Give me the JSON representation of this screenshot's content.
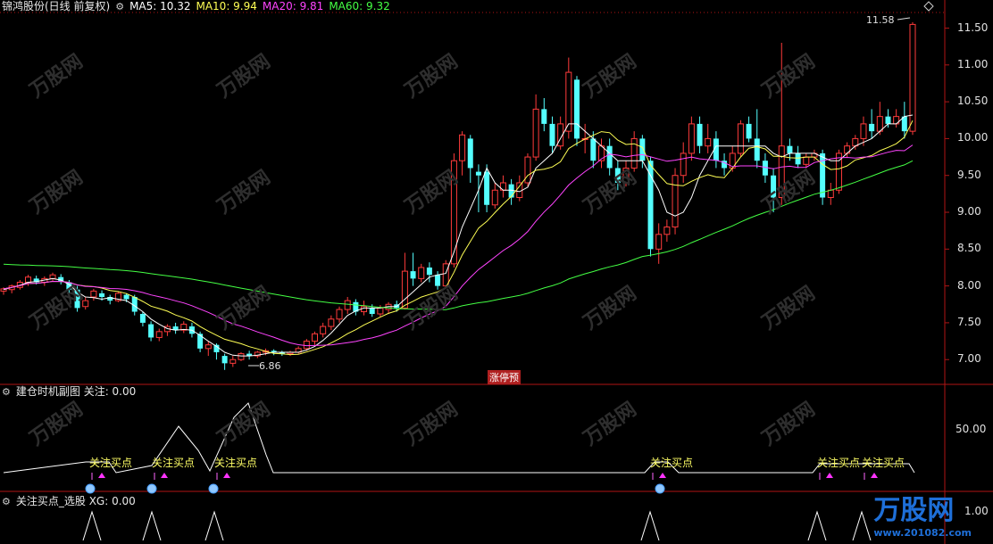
{
  "main": {
    "title": "锦鸿股份(日线 前复权)",
    "ma": [
      {
        "label": "MA5: 10.32",
        "color": "#ffffff"
      },
      {
        "label": "MA10: 9.94",
        "color": "#ffff55"
      },
      {
        "label": "MA20: 9.81",
        "color": "#ff44ff"
      },
      {
        "label": "MA60: 9.32",
        "color": "#44ff44"
      }
    ],
    "y_ticks": [
      "11.50",
      "11.00",
      "10.50",
      "10.00",
      "9.50",
      "9.00",
      "8.50",
      "8.00",
      "7.50",
      "7.00"
    ],
    "high_label": "11.58",
    "low_label": "6.86",
    "limit_tag": "涨停预"
  },
  "sub1": {
    "title": "建仓时机副图 关注: 0.00",
    "y_tick": "50.00",
    "signals": [
      "关注买点",
      "关注买点",
      "关注买点",
      "关注买点",
      "关注买点",
      "关注买点"
    ]
  },
  "sub2": {
    "title": "关注买点_选股 XG: 0.00",
    "y_tick": "1.00"
  },
  "watermark": "万股网",
  "logo": {
    "text": "万股网",
    "url": "www.201082.com"
  },
  "colors": {
    "up": "#ff3b3b",
    "down": "#54ffff",
    "grid": "#b01515"
  },
  "chart_data": {
    "type": "candlestick",
    "ylim": [
      6.7,
      11.7
    ],
    "candles": [
      [
        7.93,
        7.96,
        7.88,
        7.98
      ],
      [
        7.95,
        8.0,
        7.9,
        8.02
      ],
      [
        7.98,
        8.05,
        7.95,
        8.08
      ],
      [
        8.05,
        8.12,
        8.0,
        8.15
      ],
      [
        8.1,
        8.05,
        8.02,
        8.14
      ],
      [
        8.05,
        8.1,
        8.0,
        8.13
      ],
      [
        8.1,
        8.15,
        8.06,
        8.18
      ],
      [
        8.12,
        8.06,
        8.02,
        8.16
      ],
      [
        8.05,
        7.95,
        7.9,
        8.08
      ],
      [
        7.95,
        7.7,
        7.65,
        8.0
      ],
      [
        7.72,
        7.8,
        7.68,
        7.85
      ],
      [
        7.85,
        7.93,
        7.8,
        7.96
      ],
      [
        7.9,
        7.85,
        7.8,
        7.94
      ],
      [
        7.85,
        7.8,
        7.75,
        7.88
      ],
      [
        7.8,
        7.9,
        7.78,
        7.92
      ],
      [
        7.88,
        7.82,
        7.78,
        7.9
      ],
      [
        7.85,
        7.65,
        7.6,
        7.88
      ],
      [
        7.62,
        7.5,
        7.45,
        7.65
      ],
      [
        7.48,
        7.3,
        7.25,
        7.52
      ],
      [
        7.3,
        7.38,
        7.25,
        7.42
      ],
      [
        7.38,
        7.45,
        7.32,
        7.48
      ],
      [
        7.45,
        7.4,
        7.35,
        7.5
      ],
      [
        7.4,
        7.48,
        7.36,
        7.52
      ],
      [
        7.45,
        7.35,
        7.3,
        7.5
      ],
      [
        7.35,
        7.15,
        7.1,
        7.38
      ],
      [
        7.15,
        7.2,
        7.05,
        7.25
      ],
      [
        7.2,
        7.1,
        7.0,
        7.22
      ],
      [
        7.05,
        6.95,
        6.86,
        7.08
      ],
      [
        6.95,
        7.0,
        6.9,
        7.05
      ],
      [
        7.0,
        7.08,
        6.98,
        7.1
      ],
      [
        7.08,
        7.05,
        7.0,
        7.12
      ],
      [
        7.05,
        7.1,
        7.02,
        7.12
      ],
      [
        7.1,
        7.12,
        7.06,
        7.15
      ],
      [
        7.12,
        7.1,
        7.06,
        7.14
      ],
      [
        7.1,
        7.08,
        7.05,
        7.12
      ],
      [
        7.08,
        7.1,
        7.05,
        7.12
      ],
      [
        7.1,
        7.15,
        7.08,
        7.18
      ],
      [
        7.15,
        7.25,
        7.12,
        7.28
      ],
      [
        7.25,
        7.35,
        7.2,
        7.38
      ],
      [
        7.35,
        7.45,
        7.3,
        7.5
      ],
      [
        7.45,
        7.55,
        7.4,
        7.6
      ],
      [
        7.55,
        7.68,
        7.5,
        7.72
      ],
      [
        7.68,
        7.8,
        7.62,
        7.85
      ],
      [
        7.78,
        7.65,
        7.6,
        7.82
      ],
      [
        7.65,
        7.72,
        7.6,
        7.8
      ],
      [
        7.7,
        7.62,
        7.58,
        7.75
      ],
      [
        7.62,
        7.7,
        7.58,
        7.74
      ],
      [
        7.68,
        7.75,
        7.62,
        7.78
      ],
      [
        7.75,
        7.7,
        7.65,
        7.8
      ],
      [
        7.7,
        8.2,
        7.68,
        8.45
      ],
      [
        8.2,
        8.1,
        8.0,
        8.45
      ],
      [
        8.1,
        8.25,
        8.05,
        8.3
      ],
      [
        8.25,
        8.15,
        8.05,
        8.32
      ],
      [
        8.15,
        8.0,
        7.95,
        8.2
      ],
      [
        8.0,
        8.3,
        7.98,
        8.35
      ],
      [
        8.3,
        9.7,
        8.25,
        9.8
      ],
      [
        9.7,
        10.05,
        9.5,
        10.1
      ],
      [
        10.0,
        9.6,
        9.4,
        10.05
      ],
      [
        9.55,
        9.5,
        9.0,
        9.65
      ],
      [
        9.55,
        9.1,
        9.0,
        9.65
      ],
      [
        9.1,
        9.3,
        9.05,
        9.4
      ],
      [
        9.3,
        9.4,
        9.2,
        9.5
      ],
      [
        9.38,
        9.2,
        9.1,
        9.45
      ],
      [
        9.2,
        9.4,
        9.15,
        9.5
      ],
      [
        9.4,
        9.75,
        9.35,
        9.8
      ],
      [
        9.75,
        10.4,
        9.7,
        10.6
      ],
      [
        10.4,
        10.2,
        10.1,
        10.55
      ],
      [
        10.2,
        9.9,
        9.8,
        10.3
      ],
      [
        9.9,
        10.2,
        9.85,
        10.3
      ],
      [
        10.1,
        10.9,
        10.0,
        11.1
      ],
      [
        10.8,
        10.0,
        9.9,
        10.85
      ],
      [
        10.0,
        10.0,
        9.8,
        10.2
      ],
      [
        10.0,
        9.7,
        9.6,
        10.1
      ],
      [
        9.7,
        9.9,
        9.6,
        10.0
      ],
      [
        9.9,
        9.6,
        9.5,
        10.0
      ],
      [
        9.6,
        9.4,
        9.3,
        9.7
      ],
      [
        9.4,
        9.6,
        9.35,
        9.7
      ],
      [
        9.6,
        10.0,
        9.55,
        10.1
      ],
      [
        10.0,
        9.7,
        9.6,
        10.05
      ],
      [
        9.7,
        8.5,
        8.4,
        9.75
      ],
      [
        8.5,
        8.7,
        8.3,
        8.85
      ],
      [
        8.7,
        8.8,
        8.6,
        8.9
      ],
      [
        8.8,
        9.5,
        8.7,
        9.6
      ],
      [
        9.5,
        9.8,
        9.4,
        9.95
      ],
      [
        9.8,
        10.2,
        9.7,
        10.3
      ],
      [
        10.2,
        9.9,
        9.8,
        10.3
      ],
      [
        9.9,
        10.0,
        9.8,
        10.2
      ],
      [
        10.0,
        9.7,
        9.6,
        10.1
      ],
      [
        9.7,
        9.6,
        9.5,
        9.8
      ],
      [
        9.6,
        9.8,
        9.55,
        9.9
      ],
      [
        9.8,
        10.2,
        9.75,
        10.25
      ],
      [
        10.2,
        10.0,
        9.95,
        10.3
      ],
      [
        10.0,
        9.7,
        9.6,
        10.4
      ],
      [
        9.7,
        9.5,
        9.4,
        9.8
      ],
      [
        9.5,
        9.2,
        9.0,
        9.6
      ],
      [
        9.2,
        9.9,
        9.1,
        11.3
      ],
      [
        9.9,
        9.8,
        9.7,
        10.0
      ],
      [
        9.8,
        9.65,
        9.6,
        9.9
      ],
      [
        9.65,
        9.75,
        9.6,
        9.8
      ],
      [
        9.75,
        9.8,
        9.7,
        9.85
      ],
      [
        9.8,
        9.2,
        9.1,
        9.85
      ],
      [
        9.2,
        9.3,
        9.1,
        9.4
      ],
      [
        9.3,
        9.8,
        9.25,
        9.85
      ],
      [
        9.8,
        9.9,
        9.75,
        9.95
      ],
      [
        9.9,
        10.0,
        9.85,
        10.05
      ],
      [
        10.0,
        10.2,
        9.9,
        10.3
      ],
      [
        10.2,
        10.1,
        10.0,
        10.4
      ],
      [
        10.1,
        10.3,
        10.05,
        10.5
      ],
      [
        10.3,
        10.2,
        10.15,
        10.4
      ],
      [
        10.2,
        10.3,
        10.15,
        10.4
      ],
      [
        10.3,
        10.1,
        10.0,
        10.5
      ],
      [
        10.1,
        11.55,
        10.05,
        11.58
      ]
    ],
    "ma5": [
      7.95,
      7.98,
      8.01,
      8.05,
      8.06,
      8.08,
      8.1,
      8.08,
      8.02,
      7.92,
      7.85,
      7.84,
      7.82,
      7.84,
      7.82,
      7.8,
      7.73,
      7.65,
      7.55,
      7.48,
      7.42,
      7.4,
      7.41,
      7.4,
      7.33,
      7.25,
      7.18,
      7.1,
      7.06,
      7.05,
      7.05,
      7.06,
      7.08,
      7.1,
      7.1,
      7.1,
      7.1,
      7.13,
      7.18,
      7.26,
      7.36,
      7.48,
      7.6,
      7.66,
      7.7,
      7.7,
      7.7,
      7.72,
      7.72,
      7.82,
      7.92,
      8.02,
      8.12,
      8.15,
      8.17,
      8.46,
      8.8,
      9.05,
      9.3,
      9.6,
      9.4,
      9.3,
      9.3,
      9.28,
      9.34,
      9.6,
      9.7,
      9.8,
      10.0,
      10.2,
      10.2,
      10.1,
      10.0,
      9.9,
      9.8,
      9.7,
      9.7,
      9.7,
      9.7,
      9.5,
      9.3,
      9.0,
      8.95,
      9.0,
      9.2,
      9.5,
      9.7,
      9.9,
      9.9,
      9.9,
      9.9,
      9.9,
      9.9,
      9.9,
      9.8,
      9.75,
      9.8,
      9.8,
      9.8,
      9.8,
      9.75,
      9.7,
      9.7,
      9.8,
      9.9,
      9.95,
      10.0,
      10.1,
      10.2,
      10.2,
      10.3,
      10.32
    ]
  }
}
